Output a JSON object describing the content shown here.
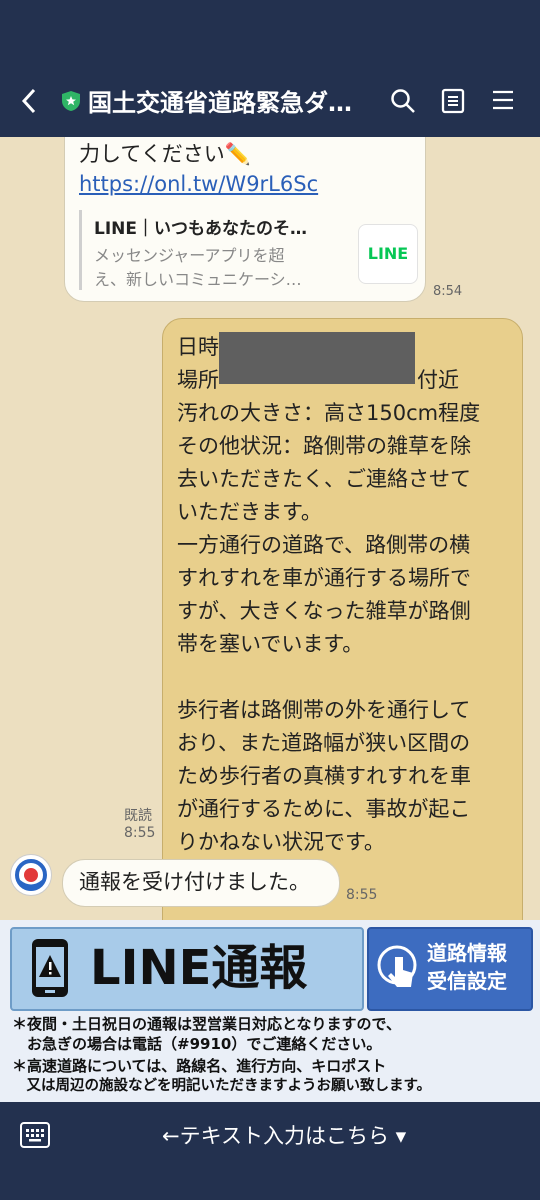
{
  "header": {
    "title": "国土交通省道路緊急ダ…",
    "icons": [
      "back-icon",
      "shield-icon",
      "search-icon",
      "notes-icon",
      "menu-icon"
    ]
  },
  "messages": {
    "first": {
      "text_line1": "力してください✏️",
      "link": "https://onl.tw/W9rL6Sc",
      "preview_title": "LINE｜いつもあなたのそ…",
      "preview_desc_line1": "メッセンジャーアプリを超",
      "preview_desc_line2": "え、新しいコミュニケーシ…",
      "logo_text": "LINE",
      "time": "8:54"
    },
    "report": {
      "line1": "日時",
      "line2": "場所",
      "line2_suffix": "付近",
      "lines": [
        "汚れの大きさ：高さ150cm程度",
        "その他状況：路側帯の雑草を除",
        "去いただきたく、ご連絡させて",
        "いただきます。",
        "一方通行の道路で、路側帯の横",
        "すれすれを車が通行する場所で",
        "すが、大きくなった雑草が路側",
        "帯を塞いでいます。",
        "",
        "歩行者は路側帯の外を通行して",
        "おり、また道路幅が狭い区間の",
        "ため歩行者の真横すれすれを車",
        "が通行するために、事故が起こ",
        "りかねない状況です。"
      ],
      "read_label": "既読",
      "time": "8:55"
    },
    "reply": {
      "text": "通報を受け付けました。",
      "time": "8:55"
    }
  },
  "banner": {
    "report_button": "LINE通報",
    "settings_line1": "道路情報",
    "settings_line2": "受信設定",
    "notes": [
      "＊夜間・土日祝日の通報は翌営業日対応となりますので、",
      "　お急ぎの場合は電話（#9910）でご連絡ください。",
      "＊高速道路については、路線名、進行方向、キロポスト",
      "　又は周辺の施設などを明記いただきますようお願い致します。"
    ]
  },
  "footer": {
    "input_hint": "←テキスト入力はこちら ▾"
  },
  "colors": {
    "header_bg": "#23314f",
    "chat_bg": "#ecdfc0",
    "sent_bubble": "#e8cf8c",
    "received_bubble": "#fdfcf6",
    "banner_blue": "#3d6cc0",
    "banner_light_blue": "#a8cbe9"
  }
}
